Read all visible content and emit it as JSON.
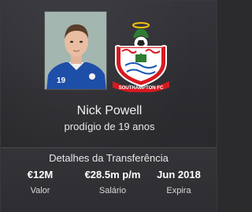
{
  "player": {
    "name": "Nick Powell",
    "subtitle": "prodígio de 19 anos",
    "shirt_number": "19",
    "photo_icon": "player-photo"
  },
  "club": {
    "crest_icon": "southampton-crest",
    "crest_text": "SOUTHAMPTON FC",
    "colors": {
      "red": "#d71920",
      "white": "#ffffff",
      "green": "#2e7d32"
    }
  },
  "transfer": {
    "title": "Detalhes da Transferência",
    "stats": [
      {
        "value": "€12M",
        "label": "Valor"
      },
      {
        "value": "€28.5m p/m",
        "label": "Salário"
      },
      {
        "value": "Jun 2018",
        "label": "Expira"
      }
    ]
  }
}
